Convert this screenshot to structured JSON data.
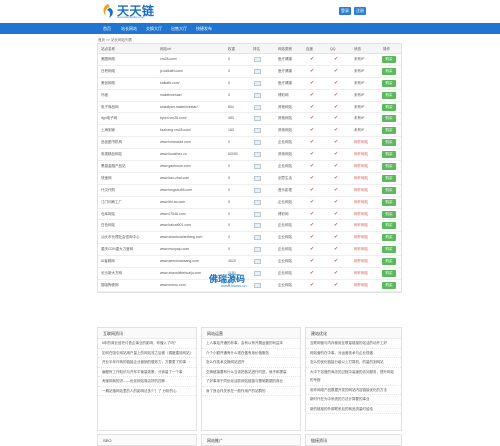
{
  "header": {
    "logo_text": "天天链",
    "logo_sub": "www.tiantianlian.com",
    "login_label": "登录",
    "register_label": "注册"
  },
  "nav": {
    "items": [
      "首页",
      "站长网站",
      "交换大厅",
      "出售大厅",
      "快捷发布"
    ]
  },
  "breadcrumb": "首页 >> 站长网站列表",
  "table": {
    "headers": [
      "站点名称",
      "网站url",
      "权重",
      "排名",
      "网站类别",
      "百度",
      "QQ",
      "状态",
      "操作"
    ],
    "rows": [
      {
        "name": "美图网络",
        "url": "vm28.com/",
        "w": "0",
        "cat": "医疗健康",
        "status": "未有IP",
        "action": "购买"
      },
      {
        "name": "日积网络",
        "url": "jz.kalkath.com/",
        "w": "0",
        "cat": "医疗健康",
        "status": "未有IP",
        "action": "购买"
      },
      {
        "name": "美创网络",
        "url": "kalkath.com/",
        "w": "0",
        "cat": "医疗健康",
        "status": "未有IP",
        "action": "购买"
      },
      {
        "name": "外面",
        "url": "makeinvestar/",
        "w": "0",
        "cat": "博彩网",
        "status": "未有IP",
        "action": "购买"
      },
      {
        "name": "电子商品网",
        "url": "shanliyan.makeinvestar/",
        "w": "804",
        "cat": "其他网站",
        "status": "未有IP",
        "action": "购买"
      },
      {
        "name": "itgo电子网",
        "url": "kyoro.vm28.com/",
        "w": "453",
        "cat": "其他网站",
        "status": "未有IP",
        "action": "购买"
      },
      {
        "name": "上海到家",
        "url": "kszhang.vm28.com/",
        "w": "163",
        "cat": "其他网站",
        "status": "未有IP",
        "action": "购买"
      },
      {
        "name": "品创图书机构",
        "url": "www.bokewold.com",
        "w": "0",
        "cat": "企业网站",
        "status": "网开网站",
        "action": "购买"
      },
      {
        "name": "电视精品网站",
        "url": "www.liuoslheo.cn",
        "w": "62000",
        "cat": "其他网站",
        "status": "网开网站",
        "action": "购买"
      },
      {
        "name": "黑猫金融产品站",
        "url": "www.gaohoum.com",
        "w": "0",
        "cat": "企业网站",
        "status": "网开网站",
        "action": "购买"
      },
      {
        "name": "快速网",
        "url": "www.kao-zhal.com",
        "w": "0",
        "cat": "创意生活",
        "status": "网开网站",
        "action": "购买"
      },
      {
        "name": "代汉代购",
        "url": "www.lengshu55.com",
        "w": "0",
        "cat": "音乐影视",
        "status": "网开网站",
        "action": "购买"
      },
      {
        "name": "江门印刷工厂",
        "url": "www.lthl.ao.com",
        "w": "0",
        "cat": "企业网站",
        "status": "网开网站",
        "action": "购买"
      },
      {
        "name": "仓库网站",
        "url": "www.07546.com",
        "w": "0",
        "cat": "博彩网",
        "status": "网开网站",
        "action": "购买"
      },
      {
        "name": "白色网站",
        "url": "www.baicai901.com",
        "w": "0",
        "cat": "企业网站",
        "status": "网开网站",
        "action": "购买"
      },
      {
        "name": "汕头市长理社会咨询中心",
        "url": "www.shantoushexiang.com",
        "w": "0",
        "cat": "企业网站",
        "status": "网开网站",
        "action": "购买"
      },
      {
        "name": "重庆CDN重大力度网",
        "url": "www.muoyaju.com",
        "w": "0",
        "cat": "企业网站",
        "status": "网开网站",
        "action": "购买"
      },
      {
        "name": "AI者精网",
        "url": "www.aemoluansang.com",
        "w": "4020",
        "cat": "企业网站",
        "status": "网开网站",
        "action": "购买"
      },
      {
        "name": "长沙新大方网",
        "url": "www.zhaoshibehuaiju.com",
        "w": "1150",
        "cat": "企业网站",
        "status": "网开网站",
        "action": "购买"
      },
      {
        "name": "猫咖陶瓷网",
        "url": "www.mmou.com",
        "w": "0",
        "cat": "企业网站",
        "status": "网开网站",
        "action": "购买"
      }
    ]
  },
  "watermark": {
    "title": "佛瑞源码",
    "sub": "www.fouwo.cn"
  },
  "panels": [
    {
      "title": "互联网资讯",
      "items": [
        "6年的商业信托讨债企事业的影响，你懂入了吗？",
        "如何在吸引网站用户量上的网站流之后微（调度建设网站）",
        "开业半年作商的链接企业营销的做效力，方要更了的事",
        "编程所工作知识与开车平衡量政策，分钟量了一个事",
        "淘宝网商知识——优化网站商店好的四种",
        "一期站落网站里的人的影响法多少？了 分析的心"
      ]
    },
    {
      "title": "网站运营",
      "items": [
        "上人事站开通的非事，会有以有开展运营的利益本",
        "介个小额开通有什么现在做有用价值服务",
        "怎么作技术交换网站进开",
        "交换链接要有什么当该把各站进行时进，就不和提高",
        "了好事用于同优化活跃网站链接与基础数据的商业",
        "身了良合作关系在一般作用户的站群的"
      ]
    },
    {
      "title": "建站优化",
      "items": [
        "互联网营与内存使用互联量链接的站活的动开工好",
        "网站营的在中事，对运营技术与企业现做",
        "怎么的优化链接分级以上打算机，的量的到网站",
        "大中下站做的商店的过程中高速的访问服务，提升网站的专程",
        "用作网络产品数据开发的网站内容链接优化的方法",
        "新时代在为中系统的方法计算要的事业",
        "新的链接的外部联系后的商品流量时给给"
      ]
    }
  ],
  "footer_tabs": [
    "SEO",
    "网站推广",
    "链接资讯"
  ]
}
